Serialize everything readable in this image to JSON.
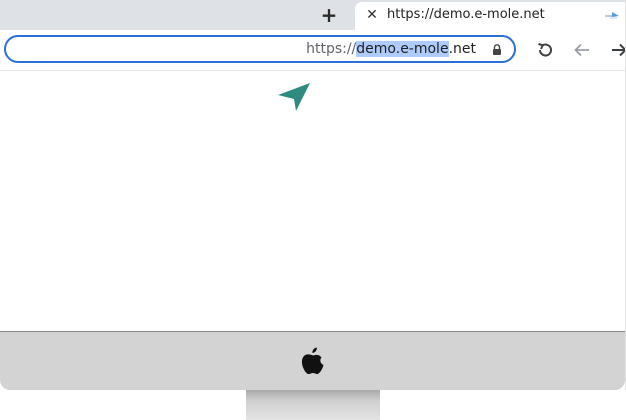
{
  "browser": {
    "new_tab_label": "+",
    "tab": {
      "title": "https://demo.e-mole.net",
      "close_label": "✕",
      "favicon_color": "#5b9bd5"
    },
    "omnibox": {
      "url_prefix": "https://",
      "url_selected": "demo.e-mole",
      "url_suffix": ".net",
      "border_color": "#2c6fd6"
    },
    "nav": {
      "reload_icon": "reload-icon",
      "back_icon": "back-arrow-icon",
      "forward_icon": "forward-arrow-icon"
    }
  },
  "page": {
    "cursor_icon": "navigation-arrow-icon",
    "cursor_color": "#2e8b80"
  },
  "device": {
    "logo_icon": "apple-logo-icon",
    "bezel_color": "#d3d3d3"
  }
}
